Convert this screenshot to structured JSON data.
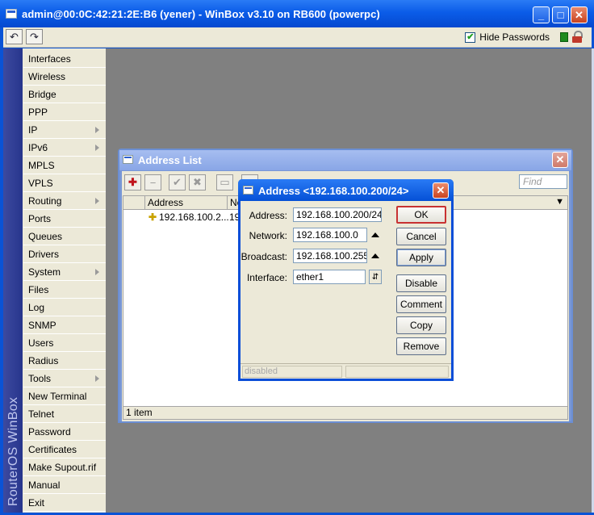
{
  "window": {
    "title": "admin@00:0C:42:21:2E:B6 (yener) - WinBox v3.10 on RB600 (powerpc)",
    "min_glyph": "_",
    "max_glyph": "□",
    "close_glyph": "✕",
    "undo_glyph": "↶",
    "redo_glyph": "↷"
  },
  "toolbar": {
    "hide_passwords_label": "Hide Passwords",
    "hide_passwords_checked": true,
    "check_glyph": "✔"
  },
  "sidebar": {
    "brand": "RouterOS WinBox",
    "items": [
      {
        "label": "Interfaces",
        "submenu": false
      },
      {
        "label": "Wireless",
        "submenu": false
      },
      {
        "label": "Bridge",
        "submenu": false
      },
      {
        "label": "PPP",
        "submenu": false
      },
      {
        "label": "IP",
        "submenu": true
      },
      {
        "label": "IPv6",
        "submenu": true
      },
      {
        "label": "MPLS",
        "submenu": false
      },
      {
        "label": "VPLS",
        "submenu": false
      },
      {
        "label": "Routing",
        "submenu": true
      },
      {
        "label": "Ports",
        "submenu": false
      },
      {
        "label": "Queues",
        "submenu": false
      },
      {
        "label": "Drivers",
        "submenu": false
      },
      {
        "label": "System",
        "submenu": true
      },
      {
        "label": "Files",
        "submenu": false
      },
      {
        "label": "Log",
        "submenu": false
      },
      {
        "label": "SNMP",
        "submenu": false
      },
      {
        "label": "Users",
        "submenu": false
      },
      {
        "label": "Radius",
        "submenu": false
      },
      {
        "label": "Tools",
        "submenu": true
      },
      {
        "label": "New Terminal",
        "submenu": false
      },
      {
        "label": "Telnet",
        "submenu": false
      },
      {
        "label": "Password",
        "submenu": false
      },
      {
        "label": "Certificates",
        "submenu": false
      },
      {
        "label": "Make Supout.rif",
        "submenu": false
      },
      {
        "label": "Manual",
        "submenu": false
      },
      {
        "label": "Exit",
        "submenu": false
      }
    ]
  },
  "address_list": {
    "title": "Address List",
    "close_glyph": "✕",
    "find_placeholder": "Find",
    "toolbar_glyphs": {
      "add": "✚",
      "remove": "−",
      "enable": "✔",
      "disable": "✖",
      "comment": "▭",
      "filter": ""
    },
    "columns": [
      "Address",
      "Ne"
    ],
    "rows": [
      {
        "icon": "✚",
        "address": "192.168.100.2...",
        "network": "192"
      }
    ],
    "status": "1 item",
    "dropdown_glyph": "▼"
  },
  "dialog": {
    "title": "Address <192.168.100.200/24>",
    "close_glyph": "✕",
    "fields": {
      "address_label": "Address:",
      "address_value": "192.168.100.200/24",
      "network_label": "Network:",
      "network_value": "192.168.100.0",
      "broadcast_label": "Broadcast:",
      "broadcast_value": "192.168.100.255",
      "interface_label": "Interface:",
      "interface_value": "ether1",
      "dropdown_glyph": "⇵"
    },
    "buttons": {
      "ok": "OK",
      "cancel": "Cancel",
      "apply": "Apply",
      "disable": "Disable",
      "comment": "Comment",
      "copy": "Copy",
      "remove": "Remove"
    },
    "status": "disabled"
  },
  "colors": {
    "titlebar": "#0b5ce8",
    "menu_bg": "#ece9d8",
    "workspace": "#808080",
    "ok_border": "#c83232"
  }
}
